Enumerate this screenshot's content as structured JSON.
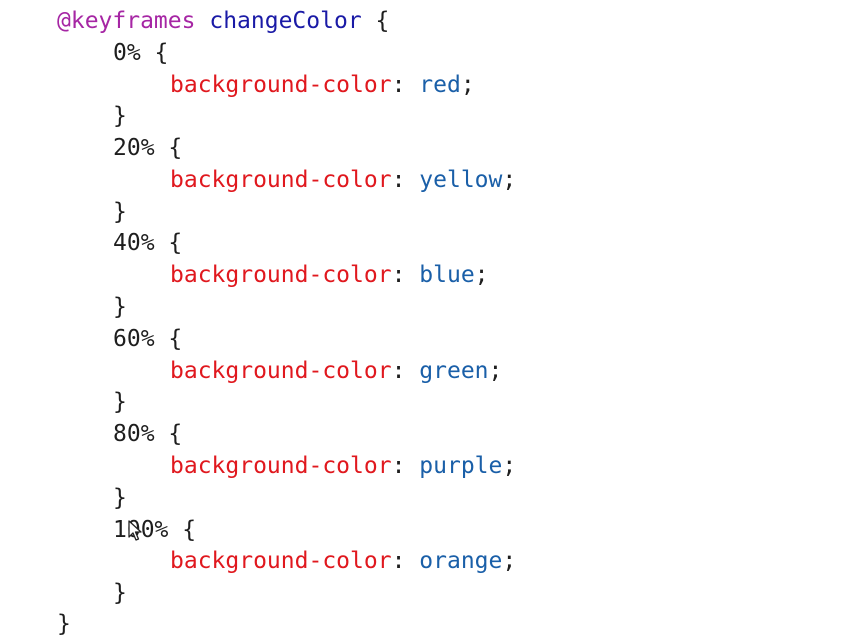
{
  "code": {
    "at_rule": "@keyframes",
    "animation_name": "changeColor",
    "open_brace": " {",
    "close_brace": "}",
    "colon": ":",
    "semicolon": ";",
    "property": "background-color",
    "frames": [
      {
        "selector": "0%",
        "value": "red"
      },
      {
        "selector": "20%",
        "value": "yellow"
      },
      {
        "selector": "40%",
        "value": "blue"
      },
      {
        "selector": "60%",
        "value": "green"
      },
      {
        "selector": "80%",
        "value": "purple"
      },
      {
        "selector": "100%",
        "value": "orange"
      }
    ]
  },
  "colors": {
    "at_rule": "#a626a4",
    "animation_name": "#1a1aa6",
    "property": "#e0181e",
    "value": "#1a5fa8",
    "text": "#1e1e1e",
    "background": "#ffffff"
  },
  "icons": {
    "cursor": "mouse-pointer-icon"
  }
}
